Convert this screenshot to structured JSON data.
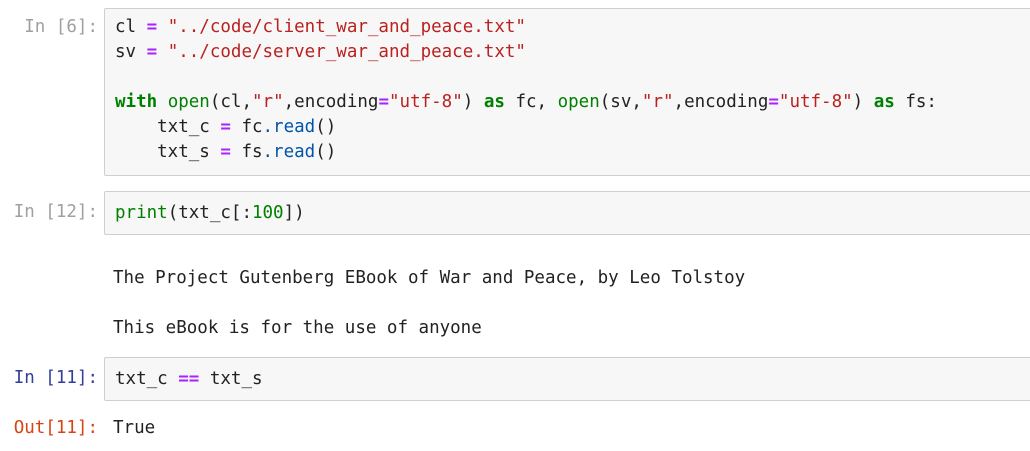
{
  "cells": [
    {
      "prompt": "In [6]:",
      "lines": [
        [
          {
            "t": "cl ",
            "c": ""
          },
          {
            "t": "=",
            "c": "op"
          },
          {
            "t": " ",
            "c": ""
          },
          {
            "t": "\"../code/client_war_and_peace.txt\"",
            "c": "str"
          }
        ],
        [
          {
            "t": "sv ",
            "c": ""
          },
          {
            "t": "=",
            "c": "op"
          },
          {
            "t": " ",
            "c": ""
          },
          {
            "t": "\"../code/server_war_and_peace.txt\"",
            "c": "str"
          }
        ],
        [],
        [
          {
            "t": "with",
            "c": "kw"
          },
          {
            "t": " ",
            "c": ""
          },
          {
            "t": "open",
            "c": "bi"
          },
          {
            "t": "(cl,",
            "c": ""
          },
          {
            "t": "\"r\"",
            "c": "str"
          },
          {
            "t": ",encoding",
            "c": ""
          },
          {
            "t": "=",
            "c": "op"
          },
          {
            "t": "\"utf-8\"",
            "c": "str"
          },
          {
            "t": ") ",
            "c": ""
          },
          {
            "t": "as",
            "c": "kw"
          },
          {
            "t": " fc, ",
            "c": ""
          },
          {
            "t": "open",
            "c": "bi"
          },
          {
            "t": "(sv,",
            "c": ""
          },
          {
            "t": "\"r\"",
            "c": "str"
          },
          {
            "t": ",encoding",
            "c": ""
          },
          {
            "t": "=",
            "c": "op"
          },
          {
            "t": "\"utf-8\"",
            "c": "str"
          },
          {
            "t": ") ",
            "c": ""
          },
          {
            "t": "as",
            "c": "kw"
          },
          {
            "t": " fs:",
            "c": ""
          }
        ],
        [
          {
            "t": "    txt_c ",
            "c": ""
          },
          {
            "t": "=",
            "c": "op"
          },
          {
            "t": " fc",
            "c": ""
          },
          {
            "t": ".read",
            "c": "attr"
          },
          {
            "t": "()",
            "c": ""
          }
        ],
        [
          {
            "t": "    txt_s ",
            "c": ""
          },
          {
            "t": "=",
            "c": "op"
          },
          {
            "t": " fs",
            "c": ""
          },
          {
            "t": ".read",
            "c": "attr"
          },
          {
            "t": "()",
            "c": ""
          }
        ]
      ]
    },
    {
      "prompt": "In [12]:",
      "lines": [
        [
          {
            "t": "print",
            "c": "bi"
          },
          {
            "t": "(txt_c[:",
            "c": ""
          },
          {
            "t": "100",
            "c": "num"
          },
          {
            "t": "])",
            "c": ""
          }
        ]
      ],
      "output_lines": [
        "The Project Gutenberg EBook of War and Peace, by Leo Tolstoy",
        "This eBook is for the use of anyone"
      ]
    },
    {
      "prompt": "In [11]:",
      "lines": [
        [
          {
            "t": "txt_c ",
            "c": ""
          },
          {
            "t": "==",
            "c": "op"
          },
          {
            "t": " txt_s",
            "c": ""
          }
        ]
      ],
      "out_prompt": "Out[11]:",
      "out_value": "True"
    }
  ]
}
